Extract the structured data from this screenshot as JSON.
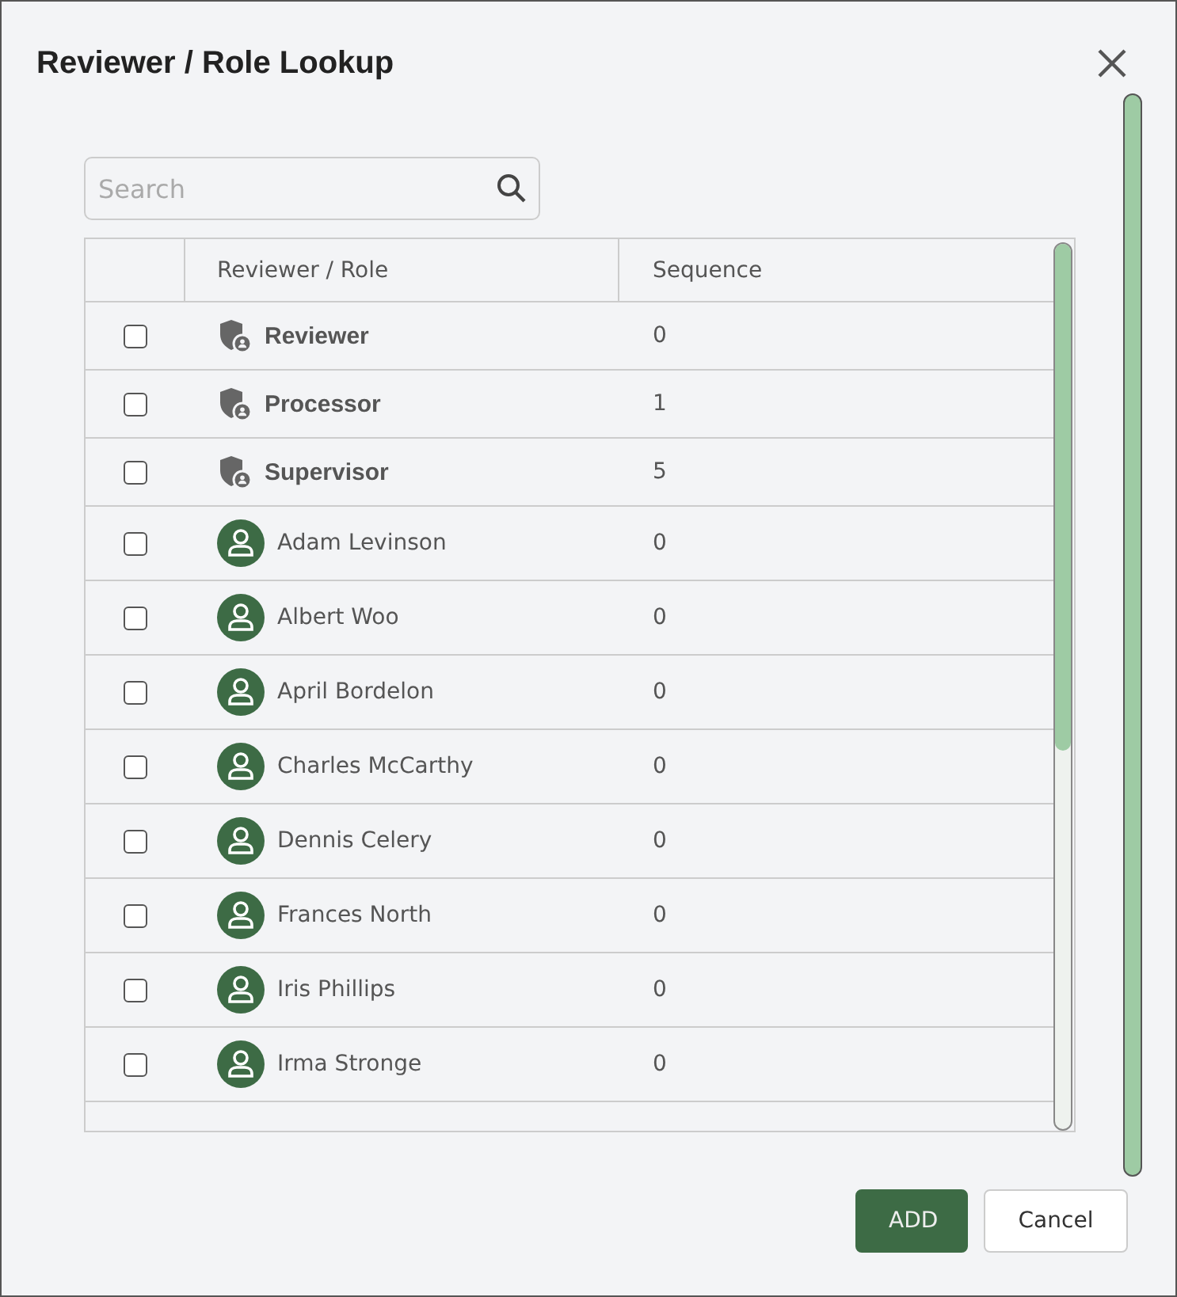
{
  "dialog": {
    "title": "Reviewer / Role Lookup"
  },
  "search": {
    "placeholder": "Search"
  },
  "table": {
    "columns": [
      "Reviewer / Role",
      "Sequence"
    ],
    "rows": [
      {
        "kind": "role",
        "name": "Reviewer",
        "sequence": "0",
        "checked": false
      },
      {
        "kind": "role",
        "name": "Processor",
        "sequence": "1",
        "checked": false
      },
      {
        "kind": "role",
        "name": "Supervisor",
        "sequence": "5",
        "checked": false
      },
      {
        "kind": "person",
        "name": "Adam Levinson",
        "sequence": "0",
        "checked": false
      },
      {
        "kind": "person",
        "name": "Albert Woo",
        "sequence": "0",
        "checked": false
      },
      {
        "kind": "person",
        "name": "April Bordelon",
        "sequence": "0",
        "checked": false
      },
      {
        "kind": "person",
        "name": "Charles McCarthy",
        "sequence": "0",
        "checked": false
      },
      {
        "kind": "person",
        "name": "Dennis Celery",
        "sequence": "0",
        "checked": false
      },
      {
        "kind": "person",
        "name": "Frances North",
        "sequence": "0",
        "checked": false
      },
      {
        "kind": "person",
        "name": "Iris Phillips",
        "sequence": "0",
        "checked": false
      },
      {
        "kind": "person",
        "name": "Irma Stronge",
        "sequence": "0",
        "checked": false
      }
    ]
  },
  "buttons": [
    {
      "kind": "primary",
      "label": "ADD"
    },
    {
      "kind": "secondary",
      "label": "Cancel"
    }
  ]
}
